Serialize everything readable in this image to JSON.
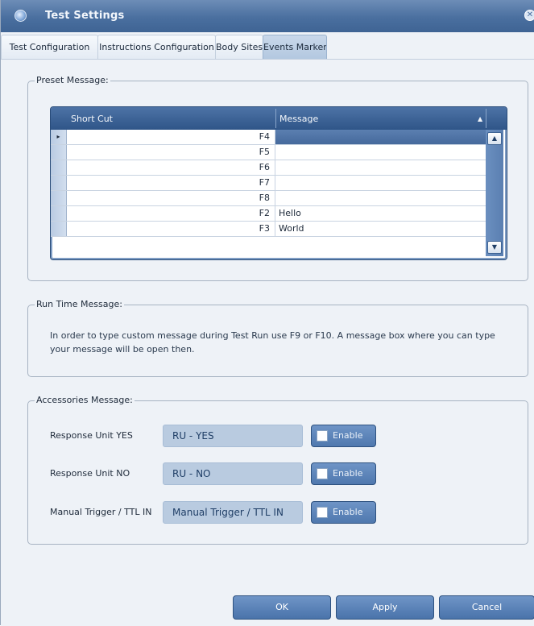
{
  "window": {
    "title": "Test Settings",
    "close_glyph": "✕"
  },
  "tabs": [
    {
      "label": "Test Configuration",
      "active": false
    },
    {
      "label": "Instructions Configuration",
      "active": false
    },
    {
      "label": "Body Sites",
      "active": false
    },
    {
      "label": "Events Marker",
      "active": true
    }
  ],
  "preset": {
    "legend": "Preset Message:",
    "columns": {
      "short_cut": "Short Cut",
      "message": "Message"
    },
    "rows": [
      {
        "short_cut": "F4",
        "message": "",
        "current": true
      },
      {
        "short_cut": "F5",
        "message": ""
      },
      {
        "short_cut": "F6",
        "message": ""
      },
      {
        "short_cut": "F7",
        "message": ""
      },
      {
        "short_cut": "F8",
        "message": ""
      },
      {
        "short_cut": "F2",
        "message": "Hello"
      },
      {
        "short_cut": "F3",
        "message": "World"
      }
    ]
  },
  "runtime": {
    "legend": "Run Time Message:",
    "text": "In order to type custom message during Test Run use F9 or F10. A message box where you can type your message will be open then."
  },
  "accessories": {
    "legend": "Accessories Message:",
    "items": [
      {
        "label": "Response Unit YES",
        "value": "RU - YES",
        "enable_label": "Enable",
        "enabled": false
      },
      {
        "label": "Response Unit NO",
        "value": "RU - NO",
        "enable_label": "Enable",
        "enabled": false
      },
      {
        "label": "Manual Trigger / TTL IN",
        "value": "Manual Trigger / TTL IN",
        "enable_label": "Enable",
        "enabled": false
      }
    ]
  },
  "footer": {
    "ok": "OK",
    "apply": "Apply",
    "cancel": "Cancel"
  },
  "icons": {
    "title": "app-logo-icon",
    "row_pointer": "▸",
    "sort": "▲",
    "scroll_up": "▲",
    "scroll_down": "▼"
  },
  "colors": {
    "titlebar": "#4a6f9f",
    "grid_header": "#2f5588",
    "selected_cell": "#4f73a5",
    "button": "#5a82b8"
  }
}
